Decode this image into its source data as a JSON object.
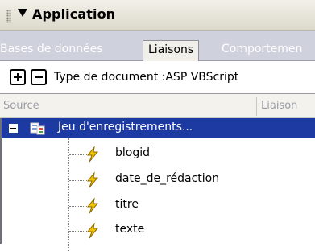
{
  "panel": {
    "title": "Application"
  },
  "tabs": [
    {
      "label": "Bases de données",
      "active": false
    },
    {
      "label": "Liaisons",
      "active": true
    },
    {
      "label": "Comportemen",
      "active": false
    }
  ],
  "toolbar": {
    "add_icon": "plus-icon",
    "remove_icon": "minus-icon",
    "doc_type_label": "Type de document :ASP VBScript"
  },
  "columns": {
    "source": "Source",
    "liaison": "Liaison"
  },
  "tree": {
    "recordset_label": "Jeu d'enregistrements...",
    "fields": [
      "blogid",
      "date_de_rédaction",
      "titre",
      "texte"
    ]
  },
  "colors": {
    "selection": "#1d3aa3",
    "tab_bar": "#cfd1dc",
    "bolt": "#e6b800"
  }
}
